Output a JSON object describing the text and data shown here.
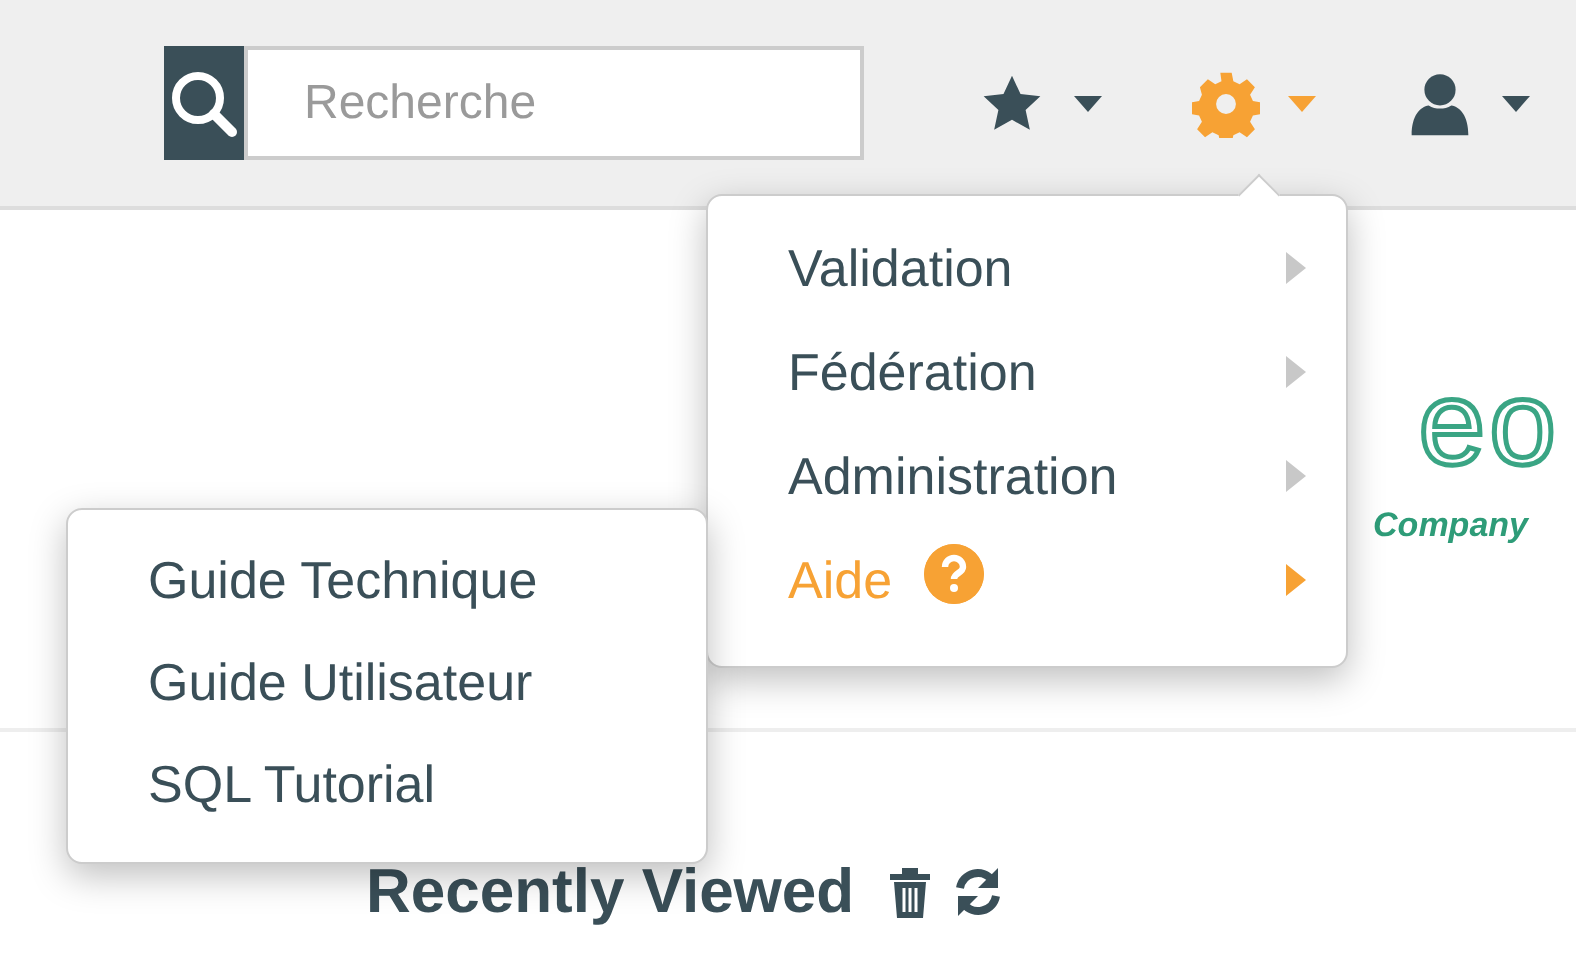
{
  "search": {
    "placeholder": "Recherche"
  },
  "toolbar": [
    {
      "kind": "star",
      "active": false
    },
    {
      "kind": "gear",
      "active": true
    },
    {
      "kind": "user",
      "active": false
    }
  ],
  "menu": {
    "items": [
      {
        "label": "Validation",
        "selected": false,
        "help": false
      },
      {
        "label": "Fédération",
        "selected": false,
        "help": false
      },
      {
        "label": "Administration",
        "selected": false,
        "help": false
      },
      {
        "label": "Aide",
        "selected": true,
        "help": true
      }
    ]
  },
  "submenu": {
    "items": [
      {
        "label": "Guide Technique"
      },
      {
        "label": "Guide Utilisateur"
      },
      {
        "label": "SQL Tutorial"
      }
    ]
  },
  "logo": {
    "name": "eo",
    "tagline": "Company"
  },
  "recent": {
    "title": "Recently Viewed"
  }
}
